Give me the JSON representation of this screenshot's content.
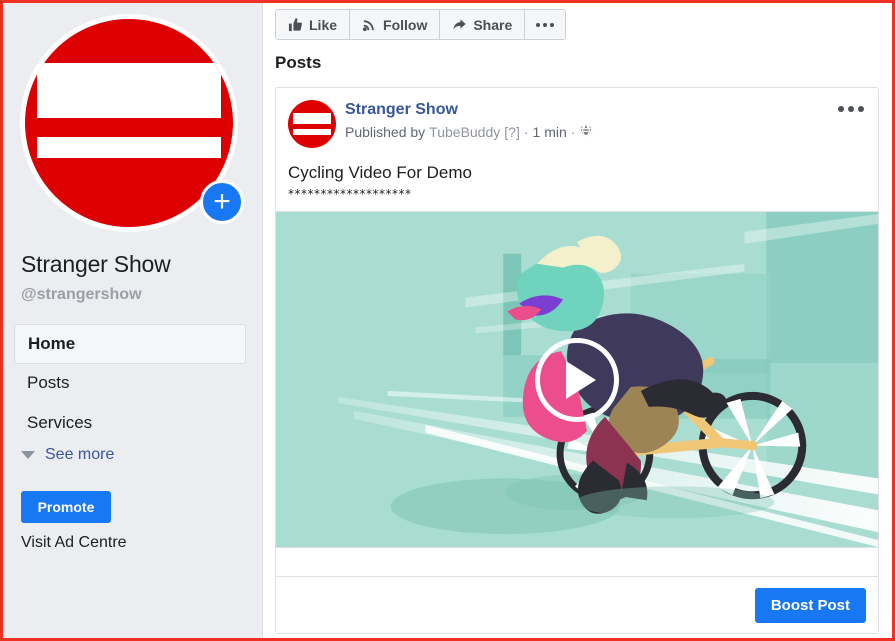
{
  "theme": {
    "accent_blue": "#1877f2",
    "link_blue": "#365899",
    "sidebar_bg": "#ebedf0",
    "border_red": "#ee3124",
    "avatar_red": "#dd0000",
    "video_bg": "#a9ddd2"
  },
  "sidebar": {
    "avatar_icon": "no-entry-sign-avatar",
    "add_icon": "plus-icon",
    "page_name": "Stranger Show",
    "handle": "@strangershow",
    "nav": [
      {
        "label": "Home",
        "active": true
      },
      {
        "label": "Posts",
        "active": false
      },
      {
        "label": "Services",
        "active": false
      }
    ],
    "see_more": "See more",
    "promote_label": "Promote",
    "visit_ad_centre": "Visit Ad Centre"
  },
  "actionbar": {
    "like": "Like",
    "follow": "Follow",
    "share": "Share",
    "more_icon": "ellipsis-icon"
  },
  "main": {
    "posts_heading": "Posts"
  },
  "post": {
    "author": "Stranger Show",
    "published_prefix": "Published by",
    "publisher": "TubeBuddy",
    "publisher_suffix": "[?]",
    "sep1": "·",
    "time": "1 min",
    "sep2": "·",
    "privacy_icon": "globe-icon",
    "menu_icon": "ellipsis-icon",
    "text": "Cycling Video For Demo",
    "stars": "*******************",
    "video_alt": "cyclist-illustration-video-thumbnail",
    "play_icon": "play-icon",
    "boost_label": "Boost Post"
  }
}
